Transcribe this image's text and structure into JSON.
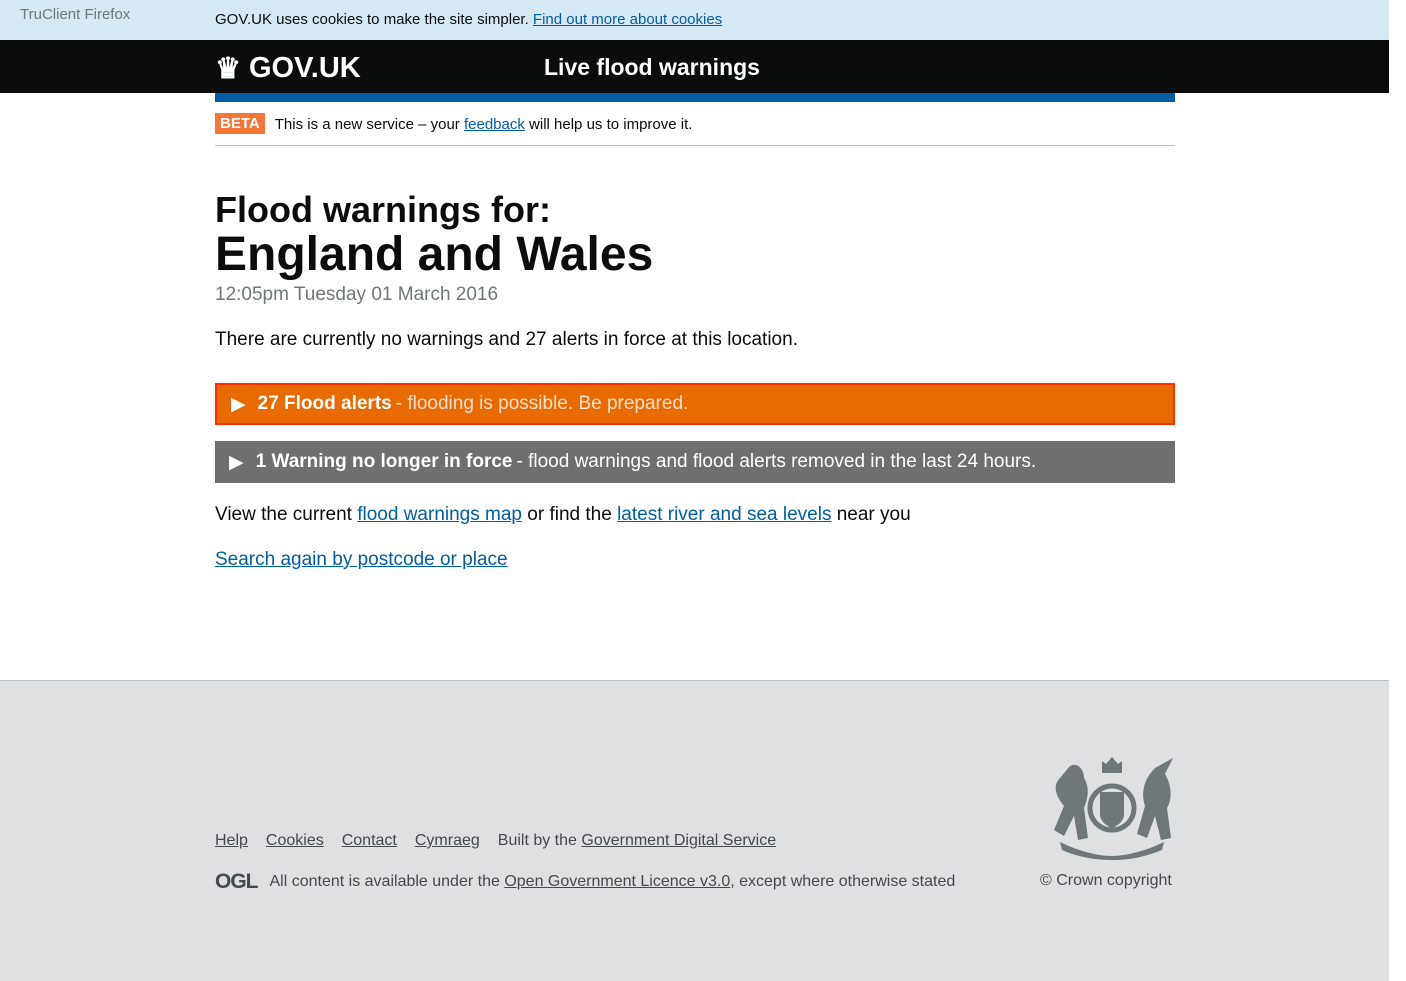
{
  "browser": {
    "label": "TruClient Firefox"
  },
  "cookie": {
    "text": "GOV.UK uses cookies to make the site simpler.",
    "link": "Find out more about cookies"
  },
  "header": {
    "logo": "GOV.UK",
    "service": "Live flood warnings"
  },
  "beta": {
    "tag": "BETA",
    "pre": "This is a new service – your",
    "link": "feedback",
    "post": "will help us to improve it."
  },
  "main": {
    "heading": "Flood warnings for:",
    "location": "England and Wales",
    "timestamp": "12:05pm Tuesday 01 March 2016",
    "summary": "There are currently no warnings and 27 alerts in force at this location.",
    "alerts": {
      "title": "27 Flood alerts",
      "desc": "- flooding is possible. Be prepared."
    },
    "removed": {
      "title": "1 Warning no longer in force",
      "desc": "- flood warnings and flood alerts removed in the last 24 hours."
    },
    "view": {
      "pre": "View the current",
      "link1": "flood warnings map",
      "mid": "or find the",
      "link2": "latest river and sea levels",
      "post": "near you"
    },
    "search_again": "Search again by postcode or place"
  },
  "footer": {
    "links": [
      "Help",
      "Cookies",
      "Contact",
      "Cymraeg"
    ],
    "built_pre": "Built by the",
    "built_link": "Government Digital Service",
    "ogl": "OGL",
    "licence_pre": "All content is available under the",
    "licence_link": "Open Government Licence v3.0",
    "licence_post": ", except where otherwise stated",
    "copyright": "© Crown copyright"
  }
}
